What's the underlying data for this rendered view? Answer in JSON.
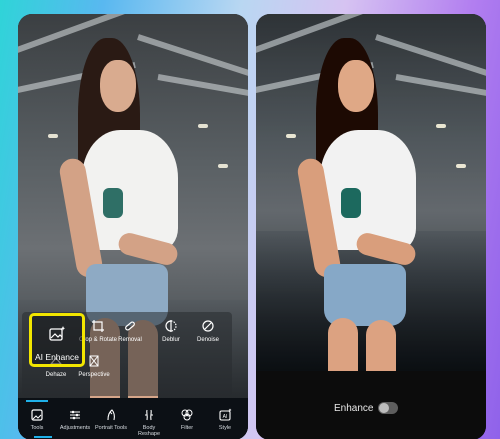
{
  "left_phone": {
    "tools": [
      {
        "label": "AI Enhance",
        "icon": "ai-enhance-icon"
      },
      {
        "label": "Crop & Rotate",
        "icon": "crop-icon"
      },
      {
        "label": "Removal",
        "icon": "bandage-icon"
      },
      {
        "label": "Deblur",
        "icon": "deblur-icon"
      },
      {
        "label": "Denoise",
        "icon": "denoise-icon"
      },
      {
        "label": "Dehaze",
        "icon": "dehaze-icon"
      },
      {
        "label": "Perspective",
        "icon": "perspective-icon"
      }
    ],
    "nav": [
      {
        "label": "Tools",
        "icon": "tools-icon"
      },
      {
        "label": "Adjustments",
        "icon": "sliders-icon"
      },
      {
        "label": "Portrait Tools",
        "icon": "portrait-icon"
      },
      {
        "label": "Body Reshape",
        "icon": "body-reshape-icon"
      },
      {
        "label": "Filter",
        "icon": "filter-icon"
      },
      {
        "label": "Style",
        "icon": "ai-style-icon"
      }
    ],
    "active_nav": "Tools",
    "highlight_color": "#f2e600"
  },
  "right_phone": {
    "enhance_label": "Enhance",
    "enhance_toggle_on": false
  }
}
